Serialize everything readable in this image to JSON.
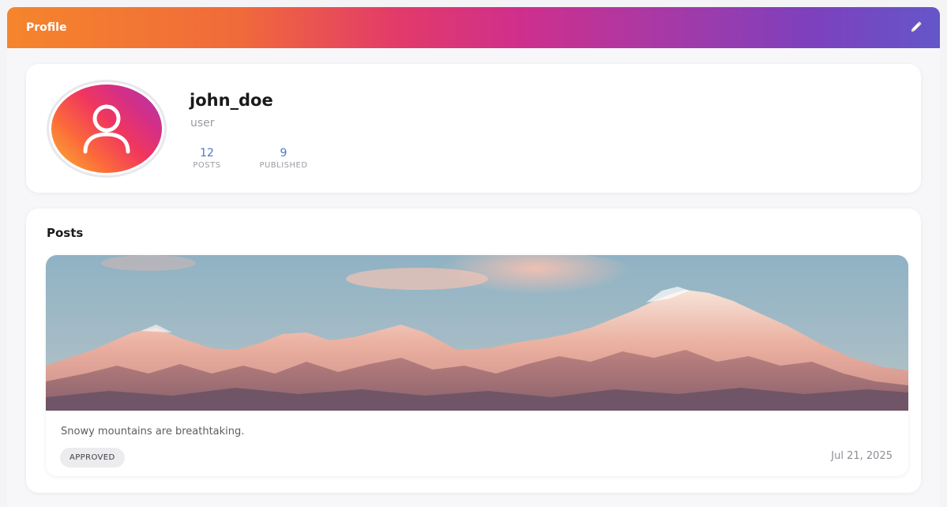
{
  "header": {
    "title": "Profile",
    "edit_icon": "pencil-icon",
    "gradient": [
      "#f5852c",
      "#e23a6a",
      "#cf2f8c",
      "#7e40bd",
      "#6456c9"
    ]
  },
  "profile": {
    "avatar_icon": "user-icon",
    "username": "john_doe",
    "role": "user",
    "stats": [
      {
        "value": "12",
        "label": "POSTS"
      },
      {
        "value": "9",
        "label": "PUBLISHED"
      }
    ],
    "stat_color": "#4a79c7"
  },
  "posts": {
    "title": "Posts",
    "items": [
      {
        "image": "snowy-mountains-photo",
        "caption": "Snowy mountains are breathtaking.",
        "status": "APPROVED",
        "date": "Jul 21, 2025"
      }
    ]
  }
}
